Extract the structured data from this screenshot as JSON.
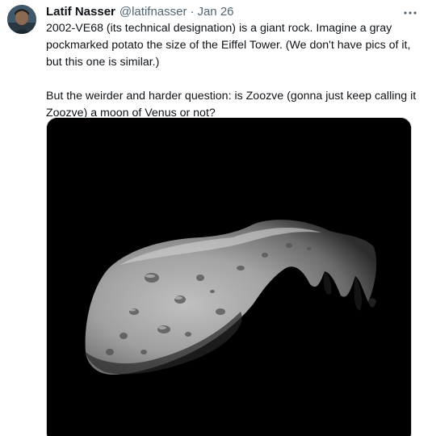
{
  "author": {
    "name": "Latif Nasser",
    "handle": "@latifnasser",
    "separator": "·",
    "date": "Jan 26"
  },
  "more_icon": "more-horizontal-icon",
  "tweet": {
    "paragraph_1": "2002-VE68 (its technical designation) is a giant rock. Imagine a gray pockmarked potato the size of the Eiffel Tower. (We don't have pics of it, but this one is similar.)",
    "paragraph_2": "But the weirder and harder question: is Zoozve (gonna just keep calling it Zoozve) a moon of Venus or not?"
  },
  "colors": {
    "text": "#0f1419",
    "secondary": "#536471",
    "media_background": "#000000"
  }
}
